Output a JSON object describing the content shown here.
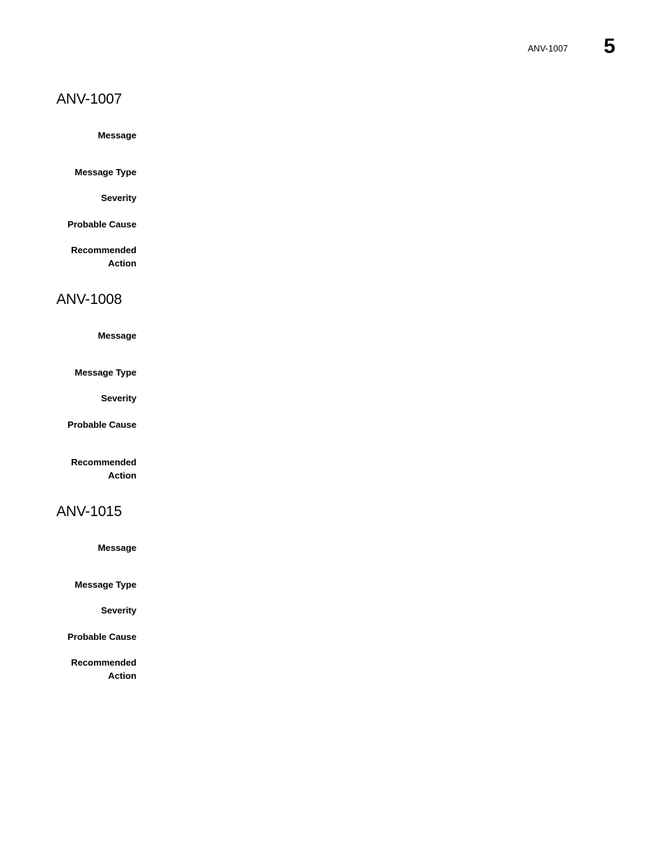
{
  "page": {
    "header": {
      "chapter_label": "ANV-1007",
      "folio": "5"
    }
  },
  "sections": [
    {
      "id": "anv-1007",
      "title": "ANV-1007",
      "title_gap_above": 0,
      "first_row_gap": 30,
      "rows": [
        {
          "label": "Message",
          "value": "",
          "gap_above": 0
        },
        {
          "label": "Message Type",
          "value": "",
          "gap_above": 34
        },
        {
          "label": "Severity",
          "value": "",
          "gap_above": 19
        },
        {
          "label": "Probable Cause",
          "value": "",
          "gap_above": 19
        },
        {
          "label": "Recommended\nAction",
          "value": "",
          "gap_above": 19
        }
      ]
    },
    {
      "id": "anv-1008",
      "title": "ANV-1008",
      "title_gap_above": 30,
      "first_row_gap": 30,
      "rows": [
        {
          "label": "Message",
          "value": "",
          "gap_above": 0
        },
        {
          "label": "Message Type",
          "value": "",
          "gap_above": 34
        },
        {
          "label": "Severity",
          "value": "",
          "gap_above": 19
        },
        {
          "label": "Probable Cause",
          "value": "",
          "gap_above": 19
        },
        {
          "label": "Recommended\nAction",
          "value": "",
          "gap_above": 36
        }
      ]
    },
    {
      "id": "anv-1015",
      "title": "ANV-1015",
      "title_gap_above": 30,
      "first_row_gap": 30,
      "rows": [
        {
          "label": "Message",
          "value": "",
          "gap_above": 0
        },
        {
          "label": "Message Type",
          "value": "",
          "gap_above": 34
        },
        {
          "label": "Severity",
          "value": "",
          "gap_above": 19
        },
        {
          "label": "Probable Cause",
          "value": "",
          "gap_above": 19
        },
        {
          "label": "Recommended\nAction",
          "value": "",
          "gap_above": 19
        }
      ]
    }
  ]
}
